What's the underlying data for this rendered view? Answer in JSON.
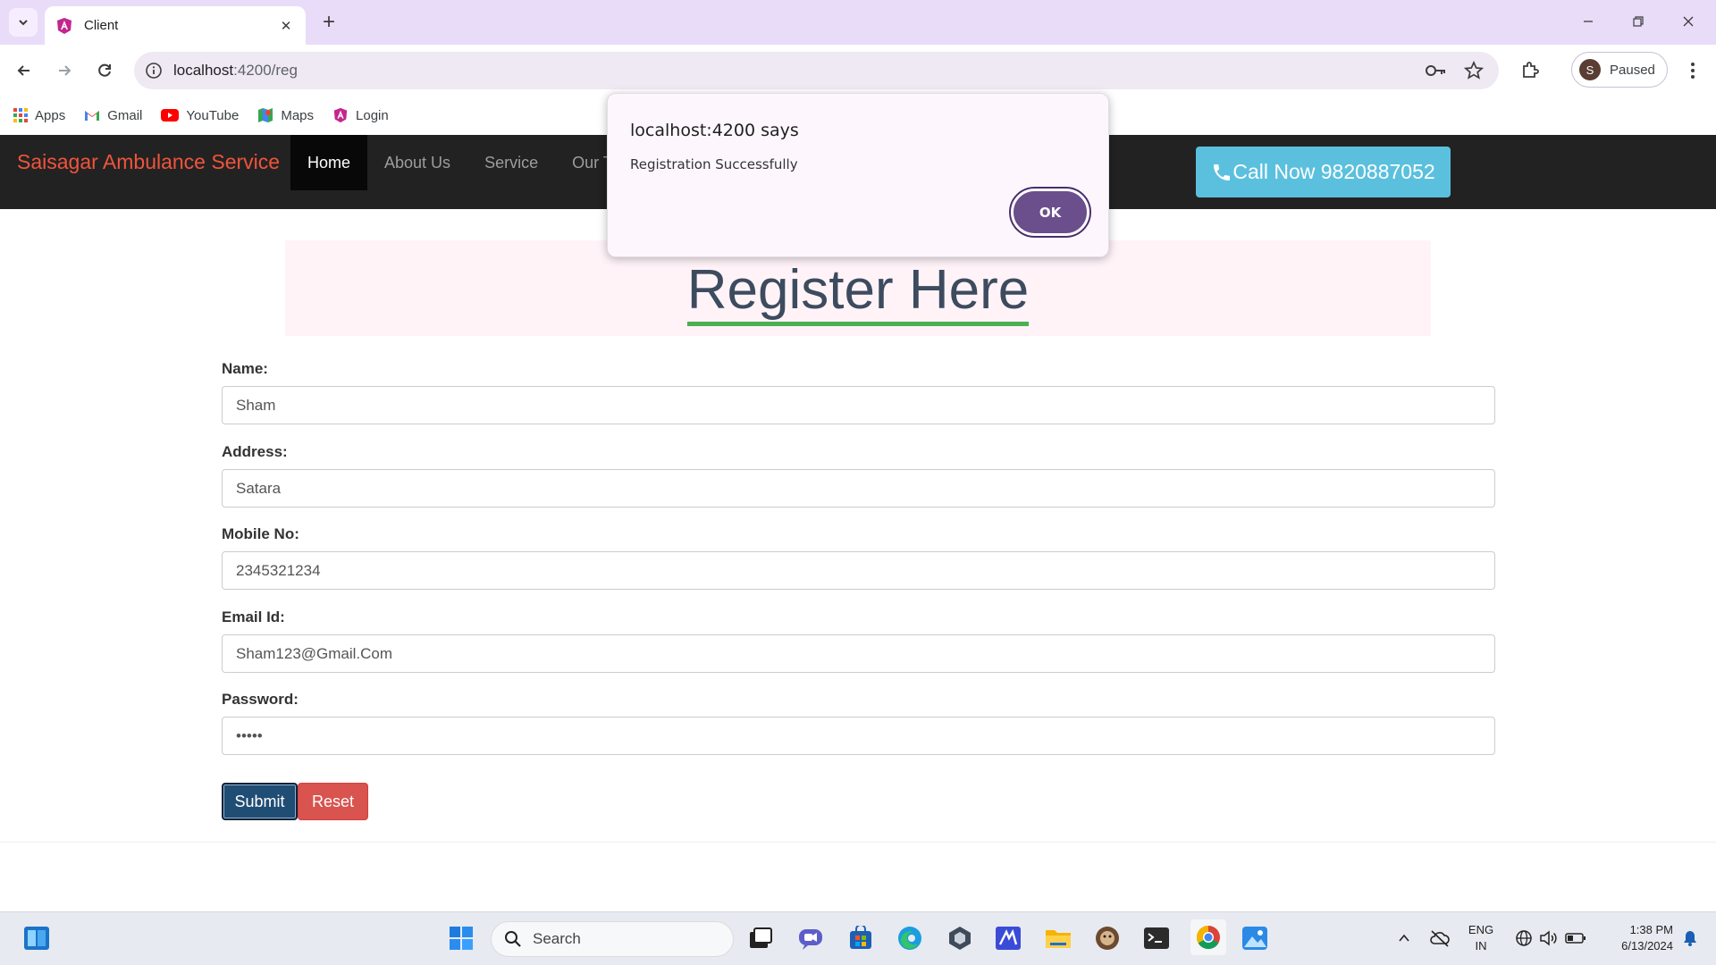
{
  "browser": {
    "tab_title": "Client",
    "url_host": "localhost",
    "url_rest": ":4200/reg",
    "profile_initial": "S",
    "profile_status": "Paused"
  },
  "bookmarks": [
    {
      "label": "Apps",
      "icon": "apps-grid-icon"
    },
    {
      "label": "Gmail",
      "icon": "gmail-icon"
    },
    {
      "label": "YouTube",
      "icon": "youtube-icon"
    },
    {
      "label": "Maps",
      "icon": "maps-icon"
    },
    {
      "label": "Login",
      "icon": "angular-icon"
    }
  ],
  "site": {
    "brand": "Saisagar Ambulance Service",
    "nav": [
      "Home",
      "About Us",
      "Service",
      "Our Te"
    ],
    "call_now": "Call Now 9820887052"
  },
  "form": {
    "heading": "Register Here",
    "fields": [
      {
        "label": "Name:",
        "value": "Sham"
      },
      {
        "label": "Address:",
        "value": "Satara"
      },
      {
        "label": "Mobile No:",
        "value": "2345321234"
      },
      {
        "label": "Email Id:",
        "value": "Sham123@Gmail.Com"
      },
      {
        "label": "Password:",
        "value": "•••••"
      }
    ],
    "submit_label": "Submit",
    "reset_label": "Reset"
  },
  "dialog": {
    "title": "localhost:4200 says",
    "message": "Registration Successfully",
    "ok_label": "OK"
  },
  "taskbar": {
    "search_placeholder": "Search",
    "lang_line1": "ENG",
    "lang_line2": "IN",
    "time": "1:38 PM",
    "date": "6/13/2024"
  },
  "colors": {
    "tabstrip": "#e8dcf8",
    "navbar": "#222222",
    "brand": "#f0543c",
    "call_button": "#5bc0de",
    "heading_underline": "#4caf50",
    "submit": "#204d74",
    "reset": "#d9534f",
    "dialog_ok": "#6b4f8c"
  }
}
